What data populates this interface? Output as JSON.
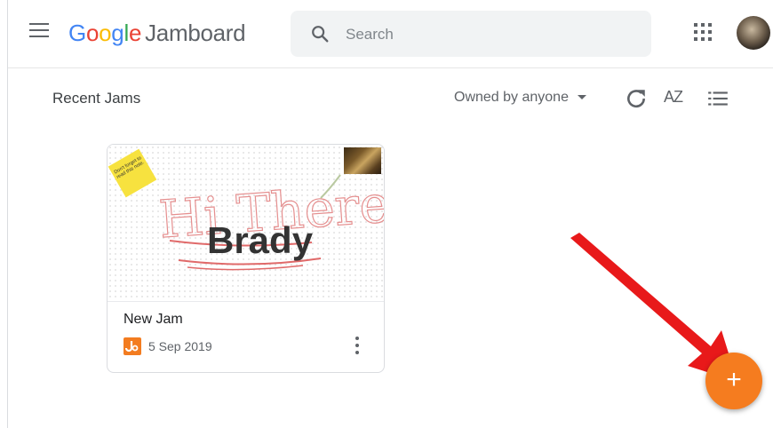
{
  "header": {
    "logo": {
      "g": "G",
      "o1": "o",
      "o2": "o",
      "g2": "g",
      "l": "l",
      "e": "e",
      "product": "Jamboard"
    },
    "search": {
      "placeholder": "Search"
    }
  },
  "toolbar": {
    "section_title": "Recent Jams",
    "owner_filter": "Owned by anyone",
    "sort_label": "AZ"
  },
  "jams": [
    {
      "title": "New Jam",
      "date": "5 Sep 2019",
      "thumbnail": {
        "handwriting": "Hi There",
        "typed_text": "Brady",
        "sticky_note": "Don't forget to read this note."
      }
    }
  ],
  "fab": {
    "label": "+"
  },
  "colors": {
    "fab": "#f57c1f",
    "arrow": "#e8191a",
    "jam_icon": "#f37c20"
  }
}
